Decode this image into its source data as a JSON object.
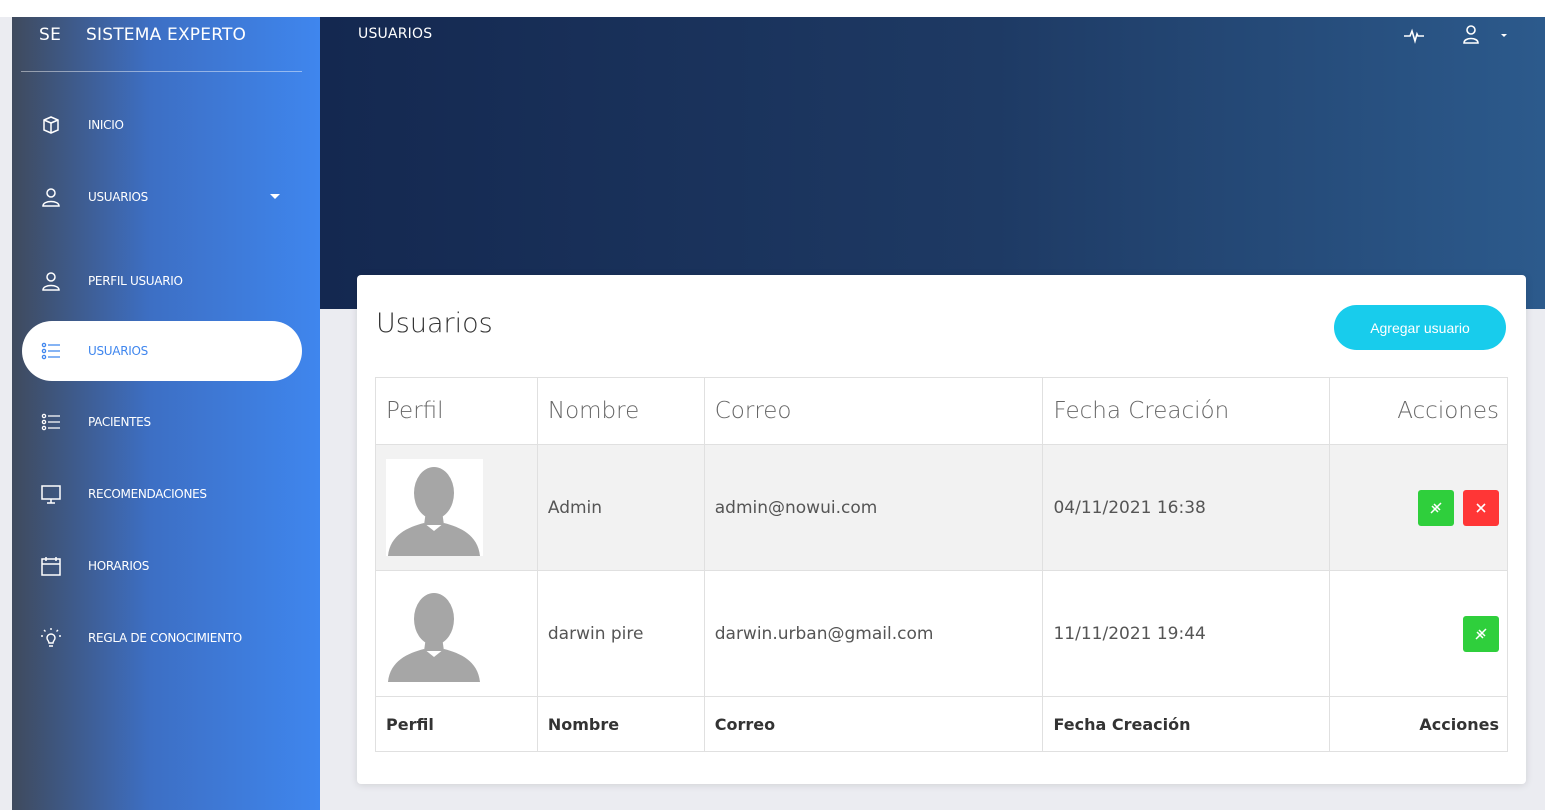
{
  "sidebar": {
    "brand_abbr": "SE",
    "brand_name": "SISTEMA EXPERTO",
    "items": [
      {
        "label": "INICIO",
        "icon": "cube-icon"
      },
      {
        "label": "USUARIOS",
        "icon": "user-icon"
      },
      {
        "label": "PERFIL USUARIO",
        "icon": "user-icon"
      },
      {
        "label": "USUARIOS",
        "icon": "list-icon"
      },
      {
        "label": "PACIENTES",
        "icon": "list-icon"
      },
      {
        "label": "RECOMENDACIONES",
        "icon": "monitor-icon"
      },
      {
        "label": "HORARIOS",
        "icon": "calendar-icon"
      },
      {
        "label": "REGLA DE CONOCIMIENTO",
        "icon": "bulb-icon"
      }
    ],
    "active_index": 3
  },
  "header": {
    "title": "USUARIOS"
  },
  "card": {
    "title": "Usuarios",
    "add_button": "Agregar usuario"
  },
  "table": {
    "headers": [
      "Perfil",
      "Nombre",
      "Correo",
      "Fecha Creación",
      "Acciones"
    ],
    "footers": [
      "Perfil",
      "Nombre",
      "Correo",
      "Fecha Creación",
      "Acciones"
    ],
    "rows": [
      {
        "name": "Admin",
        "email": "admin@nowui.com",
        "date": "04/11/2021 16:38",
        "can_delete": true
      },
      {
        "name": "darwin pire",
        "email": "darwin.urban@gmail.com",
        "date": "11/11/2021 19:44",
        "can_delete": false
      }
    ]
  },
  "colors": {
    "accent": "#3f86ee",
    "add_button": "#18ccec",
    "edit_button": "#2fcf3c",
    "delete_button": "#ff3636",
    "header_dark": "#142850"
  }
}
